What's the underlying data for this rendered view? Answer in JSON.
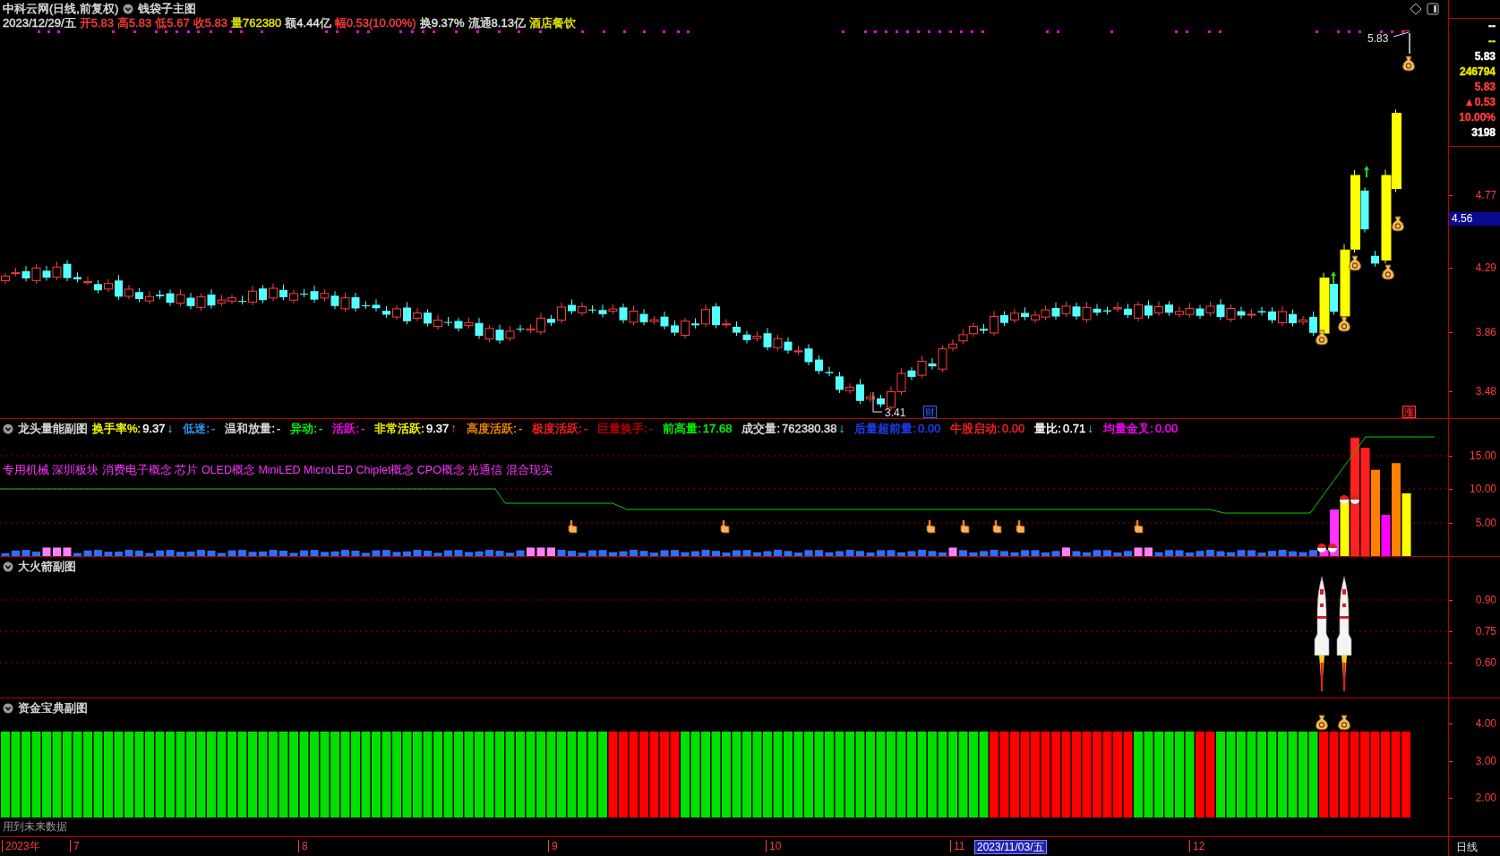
{
  "window": {
    "title": "中科云网(日线,前复权)",
    "indicator": "钱袋子主图"
  },
  "quote": [
    {
      "text": "2023/12/29/五",
      "color": "#e0e0e0"
    },
    {
      "text": "开5.83",
      "color": "#ff3c3c"
    },
    {
      "text": "高5.83",
      "color": "#ff3c3c"
    },
    {
      "text": "低5.67",
      "color": "#ff3c3c"
    },
    {
      "text": "收5.83",
      "color": "#ff3c3c"
    },
    {
      "text": "量762380",
      "color": "#e8e800"
    },
    {
      "text": "额4.44亿",
      "color": "#e0e0e0"
    },
    {
      "text": "幅0.53(10.00%)",
      "color": "#ff3c3c"
    },
    {
      "text": "换9.37%",
      "color": "#e0e0e0"
    },
    {
      "text": "流通8.13亿",
      "color": "#e0e0e0"
    },
    {
      "text": "酒店餐饮",
      "color": "#e8e800"
    }
  ],
  "main_chart": {
    "high_label": "5.83",
    "low_label": "3.41",
    "badges": [
      {
        "text": "财",
        "kind": "finance"
      },
      {
        "text": "涨",
        "kind": "limit_up"
      }
    ]
  },
  "main_axis": {
    "info": [
      {
        "text": "--",
        "color": "#ffffff"
      },
      {
        "text": "--",
        "color": "#e8e800"
      },
      {
        "text": "5.83",
        "color": "#ffffff"
      },
      {
        "text": "246794",
        "color": "#e8e800"
      },
      {
        "text": "5.83",
        "color": "#ff3c3c"
      },
      {
        "text": "▲0.53",
        "color": "#ff3c3c"
      },
      {
        "text": "10.00%",
        "color": "#ff3c3c"
      },
      {
        "text": "3198",
        "color": "#ffffff"
      }
    ],
    "ticks": [
      "4.77",
      "4.29",
      "3.86",
      "3.48"
    ],
    "cursor": "4.56"
  },
  "volume_panel": {
    "title": "龙头量能副图",
    "fields": [
      {
        "label": "换手率%:",
        "color": "#ffff00",
        "value": {
          "text": "9.37",
          "color": "#ffffff"
        },
        "arrow": "↓"
      },
      {
        "label": "低迷:",
        "color": "#3399ff",
        "value": {
          "text": "-"
        }
      },
      {
        "label": "温和放量:",
        "color": "#e0e0e0",
        "value": {
          "text": "-"
        }
      },
      {
        "label": "异动:",
        "color": "#00ff00",
        "value": {
          "text": "-"
        }
      },
      {
        "label": "活跃:",
        "color": "#ff00ff",
        "value": {
          "text": "-"
        }
      },
      {
        "label": "非常活跃:",
        "color": "#ffff00",
        "value": {
          "text": "9.37",
          "color": "#ffffff"
        },
        "arrow": "↑"
      },
      {
        "label": "高度活跃:",
        "color": "#ff8c00",
        "value": {
          "text": "-"
        }
      },
      {
        "label": "极度活跃:",
        "color": "#ff2020",
        "value": {
          "text": "-"
        }
      },
      {
        "label": "巨量换手:",
        "color": "#c00000",
        "value": {
          "text": "-"
        }
      },
      {
        "label": "前高量:",
        "color": "#00ff00",
        "value": {
          "text": "17.68",
          "color": "#00ff00"
        }
      },
      {
        "label": "成交量:",
        "color": "#e0e0e0",
        "value": {
          "text": "762380.38",
          "color": "#e0e0e0"
        },
        "arrow": "↓"
      },
      {
        "label": "后量超前量:",
        "color": "#2040ff",
        "value": {
          "text": "0.00",
          "color": "#2040ff"
        }
      },
      {
        "label": "牛股启动:",
        "color": "#ff2020",
        "value": {
          "text": "0.00",
          "color": "#ff2020"
        }
      },
      {
        "label": "量比:",
        "color": "#ffffff",
        "value": {
          "text": "0.71",
          "color": "#ffffff"
        },
        "arrow": "↓"
      },
      {
        "label": "均量金叉:",
        "color": "#ff00ff",
        "value": {
          "text": "0.00",
          "color": "#ff00ff"
        }
      }
    ],
    "concepts": "专用机械 深圳板块 消费电子概念 芯片 OLED概念 MiniLED MicroLED Chiplet概念 CPO概念 光通信 混合现实",
    "ticks": [
      "15.00",
      "10.00",
      "5.00"
    ]
  },
  "rocket_panel": {
    "title": "大火箭副图",
    "ticks": [
      "0.90",
      "0.75",
      "0.60"
    ]
  },
  "fund_panel": {
    "title": "资金宝典副图",
    "ticks": [
      "4.00",
      "3.00",
      "2.00"
    ],
    "note": "用到未来数据"
  },
  "date_axis": [
    {
      "text": "2023年",
      "kind": "label"
    },
    {
      "text": "7",
      "kind": "label"
    },
    {
      "text": "8",
      "kind": "label"
    },
    {
      "text": "9",
      "kind": "label"
    },
    {
      "text": "10",
      "kind": "label"
    },
    {
      "text": "11",
      "kind": "label"
    },
    {
      "text": "2023/11/03/五",
      "kind": "cursor"
    },
    {
      "text": "12",
      "kind": "label"
    }
  ],
  "period": "日线"
}
